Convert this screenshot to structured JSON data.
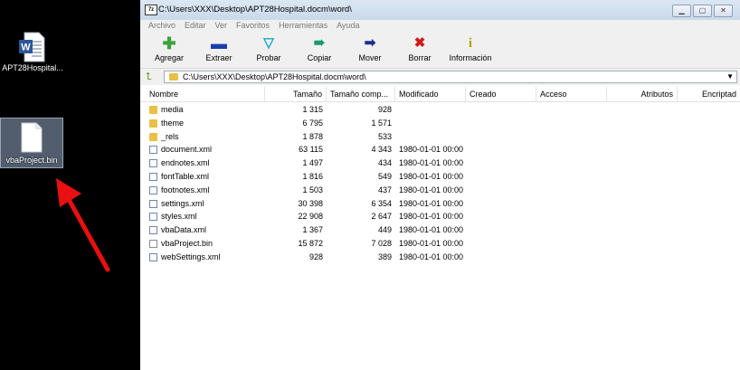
{
  "desktop": {
    "icons": [
      {
        "label": "APT28Hospital..."
      },
      {
        "label": "vbaProject.bin"
      }
    ]
  },
  "window": {
    "title": "C:\\Users\\XXX\\Desktop\\APT28Hospital.docm\\word\\",
    "app_icon": "7z",
    "menu": [
      "Archivo",
      "Editar",
      "Ver",
      "Favoritos",
      "Herramientas",
      "Ayuda"
    ],
    "toolbar": [
      {
        "label": "Agregar",
        "icon": "plus-icon",
        "color": "#3aa33a"
      },
      {
        "label": "Extraer",
        "icon": "minus-icon",
        "color": "#1a3fa6"
      },
      {
        "label": "Probar",
        "icon": "check-icon",
        "color": "#1aa6c9"
      },
      {
        "label": "Copiar",
        "icon": "double-arrow-icon",
        "color": "#1a9a70"
      },
      {
        "label": "Mover",
        "icon": "right-arrow-icon",
        "color": "#1a2f8c"
      },
      {
        "label": "Borrar",
        "icon": "x-icon",
        "color": "#d01a1a"
      },
      {
        "label": "Información",
        "icon": "info-icon",
        "color": "#b8a000"
      }
    ],
    "address": "C:\\Users\\XXX\\Desktop\\APT28Hospital.docm\\word\\",
    "columns": [
      "Nombre",
      "Tamaño",
      "Tamaño comp...",
      "Modificado",
      "Creado",
      "Acceso",
      "Atributos",
      "Encriptad"
    ],
    "files": [
      {
        "name": "media",
        "type": "folder",
        "size": "1 315",
        "packed": "928",
        "modified": ""
      },
      {
        "name": "theme",
        "type": "folder",
        "size": "6 795",
        "packed": "1 571",
        "modified": ""
      },
      {
        "name": "_rels",
        "type": "folder",
        "size": "1 878",
        "packed": "533",
        "modified": ""
      },
      {
        "name": "document.xml",
        "type": "xml",
        "size": "63 115",
        "packed": "4 343",
        "modified": "1980-01-01 00:00"
      },
      {
        "name": "endnotes.xml",
        "type": "xml",
        "size": "1 497",
        "packed": "434",
        "modified": "1980-01-01 00:00"
      },
      {
        "name": "fontTable.xml",
        "type": "xml",
        "size": "1 816",
        "packed": "549",
        "modified": "1980-01-01 00:00"
      },
      {
        "name": "footnotes.xml",
        "type": "xml",
        "size": "1 503",
        "packed": "437",
        "modified": "1980-01-01 00:00"
      },
      {
        "name": "settings.xml",
        "type": "xml",
        "size": "30 398",
        "packed": "6 354",
        "modified": "1980-01-01 00:00"
      },
      {
        "name": "styles.xml",
        "type": "xml",
        "size": "22 908",
        "packed": "2 647",
        "modified": "1980-01-01 00:00"
      },
      {
        "name": "vbaData.xml",
        "type": "xml",
        "size": "1 367",
        "packed": "449",
        "modified": "1980-01-01 00:00"
      },
      {
        "name": "vbaProject.bin",
        "type": "file",
        "size": "15 872",
        "packed": "7 028",
        "modified": "1980-01-01 00:00"
      },
      {
        "name": "webSettings.xml",
        "type": "xml",
        "size": "928",
        "packed": "389",
        "modified": "1980-01-01 00:00"
      }
    ]
  },
  "colors": {
    "arrow": "#e81010",
    "titlebar": "#c9d9ea",
    "chrome": "#f0f0f0"
  }
}
